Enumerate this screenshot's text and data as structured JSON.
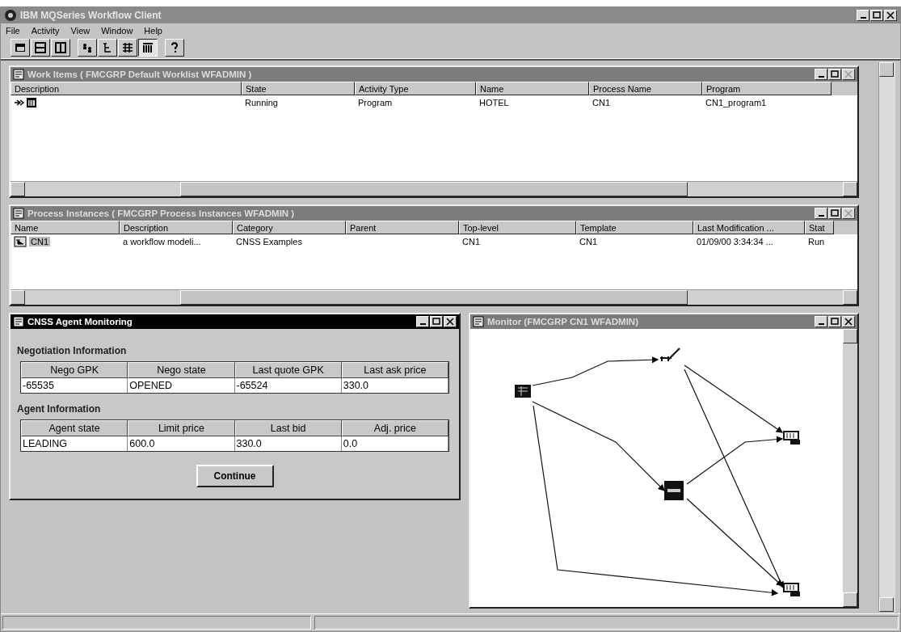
{
  "window": {
    "title": "IBM MQSeries Workflow Client"
  },
  "menu": [
    "File",
    "Activity",
    "View",
    "Window",
    "Help"
  ],
  "toolbar": [
    {
      "kind": "folder",
      "pressed": false
    },
    {
      "kind": "hsplit",
      "pressed": false
    },
    {
      "kind": "vsplit",
      "pressed": false
    },
    {
      "kind": "users",
      "pressed": false
    },
    {
      "kind": "tree",
      "pressed": false
    },
    {
      "kind": "list",
      "pressed": false
    },
    {
      "kind": "grid",
      "pressed": true
    },
    {
      "kind": "help",
      "pressed": false
    }
  ],
  "work_items": {
    "title": "Work Items  ( FMCGRP Default Worklist WFADMIN )",
    "columns": [
      "Description",
      "State",
      "Activity Type",
      "Name",
      "Process Name",
      "Program"
    ],
    "rows": [
      {
        "cells": [
          null,
          "Running",
          "Program",
          "HOTEL",
          "CN1",
          "CN1_program1"
        ],
        "running": true
      }
    ]
  },
  "process_instances": {
    "title": "Process Instances  ( FMCGRP Process Instances WFADMIN )",
    "columns": [
      "Name",
      "Description",
      "Category",
      "Parent",
      "Top-level",
      "Template",
      "Last Modification ...",
      "Stat"
    ],
    "rows": [
      {
        "cells": [
          "CN1",
          "a workflow modeli...",
          "CNSS Examples",
          null,
          "CN1",
          "CN1",
          "01/09/00 3:34:34 ...",
          "Run"
        ],
        "selected": true
      }
    ]
  },
  "agent_monitoring": {
    "title": "CNSS Agent Monitoring",
    "sections": [
      {
        "heading": "Negotiation Information",
        "columns": [
          "Nego GPK",
          "Nego state",
          "Last quote GPK",
          "Last ask price"
        ],
        "rows": [
          [
            "-65535",
            "OPENED",
            "-65524",
            "330.0"
          ]
        ]
      },
      {
        "heading": "Agent Information",
        "columns": [
          "Agent state",
          "Limit price",
          "Last bid",
          "Adj. price"
        ],
        "rows": [
          [
            "LEADING",
            "600.0",
            "330.0",
            "0.0"
          ]
        ]
      }
    ],
    "button": "Continue"
  },
  "monitor": {
    "title": "Monitor (FMCGRP CN1 WFADMIN)"
  }
}
